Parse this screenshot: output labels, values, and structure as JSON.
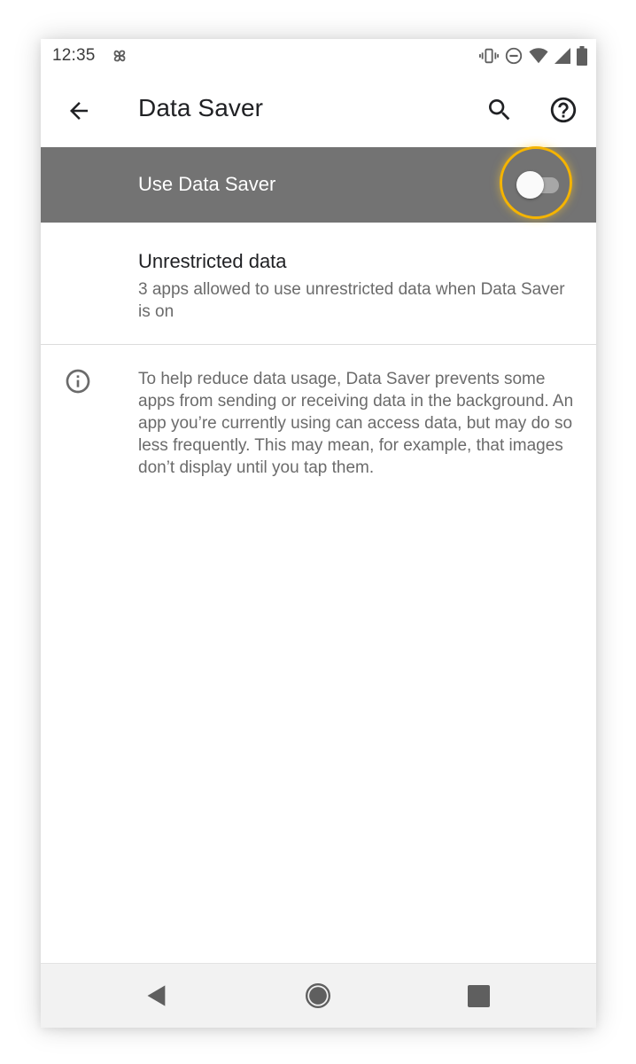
{
  "status_bar": {
    "time": "12:35",
    "icons": [
      "pinwheel-icon",
      "vibrate-icon",
      "do-not-disturb-icon",
      "wifi-icon",
      "cellular-signal-icon",
      "battery-icon"
    ]
  },
  "app_bar": {
    "title": "Data Saver",
    "icons": [
      "back-arrow-icon",
      "search-icon",
      "help-icon"
    ]
  },
  "master_switch": {
    "label": "Use Data Saver",
    "enabled": false
  },
  "unrestricted_data": {
    "title": "Unrestricted data",
    "summary": "3 apps allowed to use unrestricted data when Data Saver is on"
  },
  "footer_info": {
    "icon": "info-icon",
    "text": "To help reduce data usage, Data Saver prevents some apps from sending or receiving data in the background. An app you’re currently using can access data, but may do so less frequently. This may mean, for example, that images don’t display until you tap them."
  },
  "nav_bar": {
    "icons": [
      "nav-back-icon",
      "nav-home-icon",
      "nav-recents-icon"
    ]
  },
  "colors": {
    "master_switch_bg": "#737373",
    "highlight_ring": "#f5b400",
    "secondary_text": "#6b6b6b",
    "primary_text": "#202124"
  }
}
